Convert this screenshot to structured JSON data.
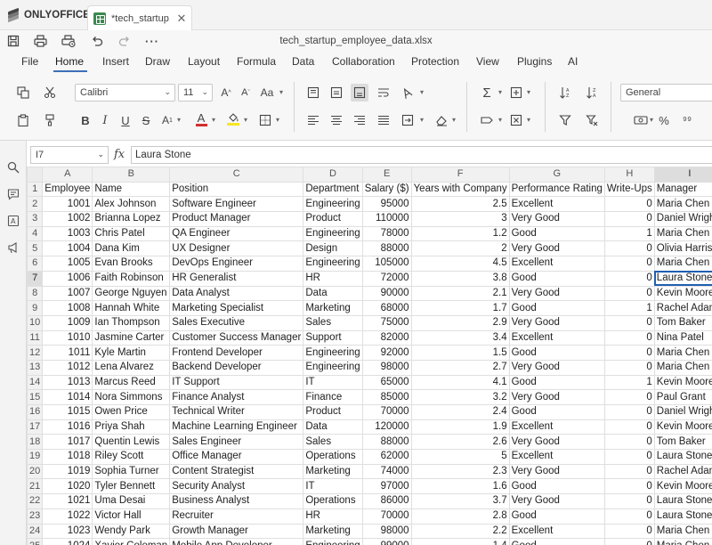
{
  "app": {
    "logo_text": "ONLYOFFICE",
    "tab_title": "*tech_startup...",
    "file_name": "tech_startup_employee_data.xlsx"
  },
  "menu": {
    "tabs": [
      "File",
      "Home",
      "Insert",
      "Draw",
      "Layout",
      "Formula",
      "Data",
      "Collaboration",
      "Protection",
      "View",
      "Plugins",
      "AI"
    ],
    "active": "Home"
  },
  "ribbon": {
    "font_name": "Calibri",
    "font_size": "11",
    "number_format": "General"
  },
  "formula_bar": {
    "cell_ref": "I7",
    "fx_label": "fx",
    "content": "Laura Stone"
  },
  "grid": {
    "columns": [
      "A",
      "B",
      "C",
      "D",
      "E",
      "F",
      "G",
      "H",
      "I"
    ],
    "active_col": "I",
    "active_row": 7,
    "header_row": [
      "Employee",
      "Name",
      "Position",
      "Department",
      "Salary ($)",
      "Years with Company",
      "Performance Rating",
      "Write-Ups",
      "Manager"
    ],
    "rows": [
      [
        "1001",
        "Alex Johnson",
        "Software Engineer",
        "Engineering",
        "95000",
        "2.5",
        "Excellent",
        "0",
        "Maria Chen"
      ],
      [
        "1002",
        "Brianna Lopez",
        "Product Manager",
        "Product",
        "110000",
        "3",
        "Very Good",
        "0",
        "Daniel Wright"
      ],
      [
        "1003",
        "Chris Patel",
        "QA Engineer",
        "Engineering",
        "78000",
        "1.2",
        "Good",
        "1",
        "Maria Chen"
      ],
      [
        "1004",
        "Dana Kim",
        "UX Designer",
        "Design",
        "88000",
        "2",
        "Very Good",
        "0",
        "Olivia Harris"
      ],
      [
        "1005",
        "Evan Brooks",
        "DevOps Engineer",
        "Engineering",
        "105000",
        "4.5",
        "Excellent",
        "0",
        "Maria Chen"
      ],
      [
        "1006",
        "Faith Robinson",
        "HR Generalist",
        "HR",
        "72000",
        "3.8",
        "Good",
        "0",
        "Laura Stone"
      ],
      [
        "1007",
        "George Nguyen",
        "Data Analyst",
        "Data",
        "90000",
        "2.1",
        "Very Good",
        "0",
        "Kevin Moore"
      ],
      [
        "1008",
        "Hannah White",
        "Marketing Specialist",
        "Marketing",
        "68000",
        "1.7",
        "Good",
        "1",
        "Rachel Adams"
      ],
      [
        "1009",
        "Ian Thompson",
        "Sales Executive",
        "Sales",
        "75000",
        "2.9",
        "Very Good",
        "0",
        "Tom Baker"
      ],
      [
        "1010",
        "Jasmine Carter",
        "Customer Success Manager",
        "Support",
        "82000",
        "3.4",
        "Excellent",
        "0",
        "Nina Patel"
      ],
      [
        "1011",
        "Kyle Martin",
        "Frontend Developer",
        "Engineering",
        "92000",
        "1.5",
        "Good",
        "0",
        "Maria Chen"
      ],
      [
        "1012",
        "Lena Alvarez",
        "Backend Developer",
        "Engineering",
        "98000",
        "2.7",
        "Very Good",
        "0",
        "Maria Chen"
      ],
      [
        "1013",
        "Marcus Reed",
        "IT Support",
        "IT",
        "65000",
        "4.1",
        "Good",
        "1",
        "Kevin Moore"
      ],
      [
        "1014",
        "Nora Simmons",
        "Finance Analyst",
        "Finance",
        "85000",
        "3.2",
        "Very Good",
        "0",
        "Paul Grant"
      ],
      [
        "1015",
        "Owen Price",
        "Technical Writer",
        "Product",
        "70000",
        "2.4",
        "Good",
        "0",
        "Daniel Wright"
      ],
      [
        "1016",
        "Priya Shah",
        "Machine Learning Engineer",
        "Data",
        "120000",
        "1.9",
        "Excellent",
        "0",
        "Kevin Moore"
      ],
      [
        "1017",
        "Quentin Lewis",
        "Sales Engineer",
        "Sales",
        "88000",
        "2.6",
        "Very Good",
        "0",
        "Tom Baker"
      ],
      [
        "1018",
        "Riley Scott",
        "Office Manager",
        "Operations",
        "62000",
        "5",
        "Excellent",
        "0",
        "Laura Stone"
      ],
      [
        "1019",
        "Sophia Turner",
        "Content Strategist",
        "Marketing",
        "74000",
        "2.3",
        "Very Good",
        "0",
        "Rachel Adams"
      ],
      [
        "1020",
        "Tyler Bennett",
        "Security Analyst",
        "IT",
        "97000",
        "1.6",
        "Good",
        "0",
        "Kevin Moore"
      ],
      [
        "1021",
        "Uma Desai",
        "Business Analyst",
        "Operations",
        "86000",
        "3.7",
        "Very Good",
        "0",
        "Laura Stone"
      ],
      [
        "1022",
        "Victor Hall",
        "Recruiter",
        "HR",
        "70000",
        "2.8",
        "Good",
        "0",
        "Laura Stone"
      ],
      [
        "1023",
        "Wendy Park",
        "Growth Manager",
        "Marketing",
        "98000",
        "2.2",
        "Excellent",
        "0",
        "Maria Chen"
      ],
      [
        "1024",
        "Xavier Coleman",
        "Mobile App Developer",
        "Engineering",
        "99000",
        "1.4",
        "Good",
        "0",
        "Maria Chen"
      ]
    ]
  },
  "icons": {
    "save": "save-icon",
    "print": "print-icon",
    "quick-print": "quick-print-icon",
    "undo": "undo-icon",
    "redo": "redo-icon",
    "more": "more-icon",
    "search": "search-icon",
    "comments": "comment-icon",
    "spellcheck": "spellcheck-icon",
    "feedback": "feedback-icon"
  },
  "colors": {
    "accent": "#3d6fb8",
    "selection": "#1f5fb1",
    "font_color": "#d32f2f",
    "highlight": "#f5e625",
    "app_brand": "#3a8a4f"
  }
}
